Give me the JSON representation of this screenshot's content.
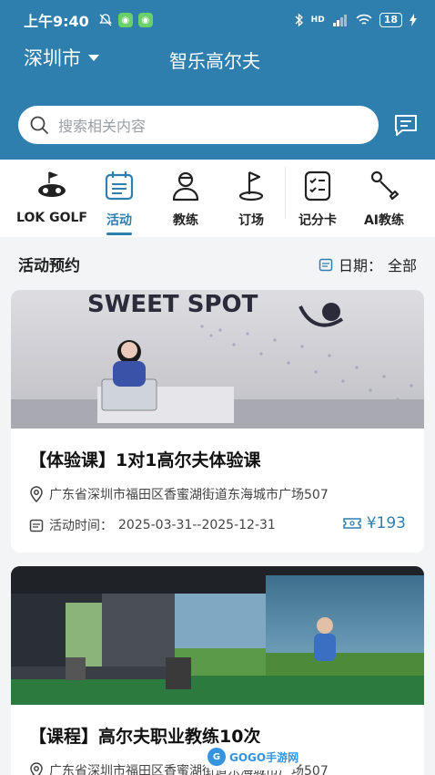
{
  "status_bar": {
    "time": "上午9:40",
    "network": "HD",
    "battery": "18"
  },
  "header": {
    "city": "深圳市",
    "app_title": "智乐高尔夫"
  },
  "search": {
    "placeholder": "搜索相关内容"
  },
  "nav": {
    "items": [
      {
        "label": "LOK GOLF",
        "icon": "golf-cart-icon"
      },
      {
        "label": "活动",
        "icon": "calendar-icon",
        "active": true
      },
      {
        "label": "教练",
        "icon": "coach-icon"
      },
      {
        "label": "订场",
        "icon": "flag-icon"
      },
      {
        "label": "记分卡",
        "icon": "scorecard-icon"
      },
      {
        "label": "AI教练",
        "icon": "golf-club-icon"
      }
    ]
  },
  "section": {
    "title": "活动预约",
    "date_label": "日期：",
    "date_value": "全部"
  },
  "cards": [
    {
      "title": "【体验课】1对1高尔夫体验课",
      "address": "广东省深圳市福田区香蜜湖街道东海城市广场507",
      "time_label": "活动时间：",
      "time_value": "2025-03-31--2025-12-31",
      "price": "¥193",
      "photo_text": "SWEET SPOT"
    },
    {
      "title": "【课程】高尔夫职业教练10次",
      "address": "广东省深圳市福田区香蜜湖街道东海城市广场507"
    }
  ],
  "watermark": {
    "logo": "G",
    "text": "GOGO手游网"
  },
  "colors": {
    "brand": "#2f7fae",
    "background": "#f3f4f6"
  }
}
